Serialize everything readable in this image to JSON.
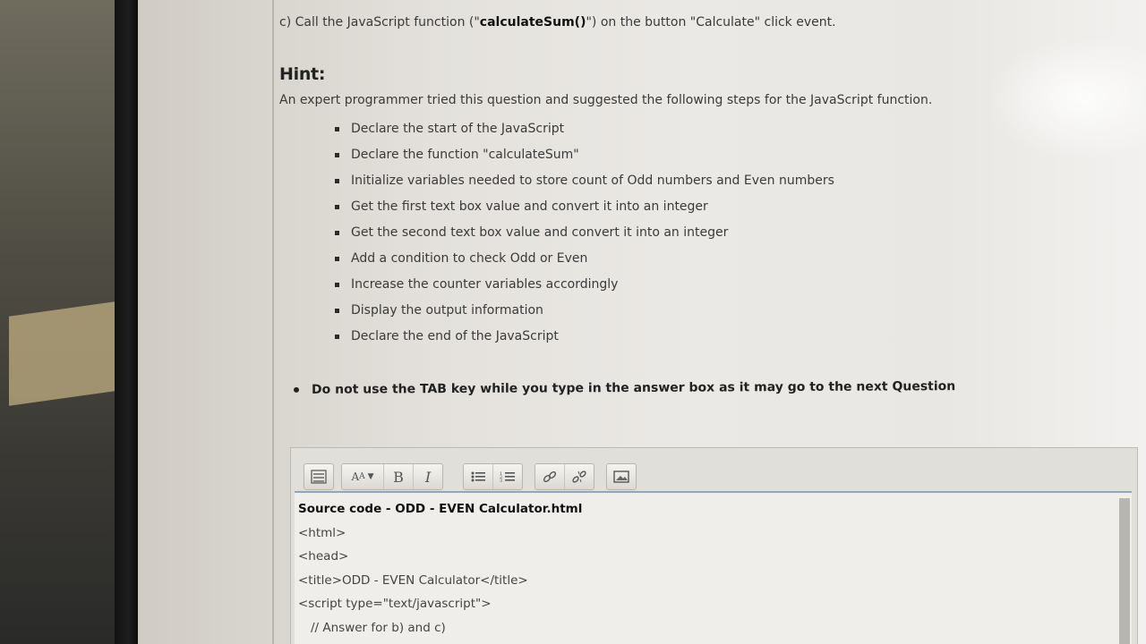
{
  "question": {
    "part_c_prefix": "c)  Call the JavaScript function (\"",
    "part_c_fn": "calculateSum()",
    "part_c_suffix": "\") on the button  \"Calculate\" click event."
  },
  "hint": {
    "title": "Hint:",
    "intro": "An expert programmer tried this question and suggested the following steps for the JavaScript function.",
    "steps": [
      "Declare the start of the JavaScript",
      "Declare the function \"calculateSum\"",
      "Initialize variables needed to store count of Odd numbers and Even numbers",
      "Get the first text box value and convert it into an integer",
      "Get the second text box value and convert it into an integer",
      "Add a condition to check Odd or Even",
      "Increase the counter variables accordingly",
      "Display the output information",
      "Declare the end of the JavaScript"
    ]
  },
  "note": "Do not use the TAB key while you type in the answer box as it may go to the next Question",
  "toolbar": {
    "bold": "B",
    "italic": "I",
    "font_size": "A",
    "icons": [
      "toolbar-toggle-icon",
      "font-size-icon",
      "bold-icon",
      "italic-icon",
      "bullet-list-icon",
      "numbered-list-icon",
      "link-icon",
      "unlink-icon",
      "image-icon"
    ]
  },
  "editor": {
    "lines": [
      "Source code - ODD - EVEN Calculator.html",
      "<html>",
      "<head>",
      "<title>ODD - EVEN Calculator</title>",
      "<script type=\"text/javascript\">",
      "// Answer for b) and c)"
    ]
  }
}
